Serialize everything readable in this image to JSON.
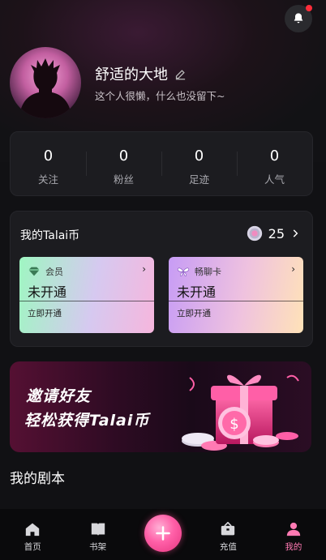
{
  "profile": {
    "name": "舒适的大地",
    "bio": "这个人很懒，什么也没留下~"
  },
  "stats": [
    {
      "value": "0",
      "label": "关注"
    },
    {
      "value": "0",
      "label": "粉丝"
    },
    {
      "value": "0",
      "label": "足迹"
    },
    {
      "value": "0",
      "label": "人气"
    }
  ],
  "coins": {
    "title": "我的Talai币",
    "count": "25"
  },
  "memberships": {
    "vip": {
      "name": "会员",
      "status": "未开通",
      "action": "立即开通"
    },
    "chat": {
      "name": "畅聊卡",
      "status": "未开通",
      "action": "立即开通"
    }
  },
  "banner": {
    "line1": "邀请好友",
    "line2": "轻松获得Talai币"
  },
  "section": {
    "scripts_title": "我的剧本"
  },
  "tabbar": {
    "home": "首页",
    "shelf": "书架",
    "recharge": "充值",
    "mine": "我的"
  },
  "colors": {
    "accent": "#ff7ab3",
    "notification_dot": "#ff2d3a",
    "background": "#111114",
    "card": "#1c1c20"
  },
  "icons": {
    "bell": "bell-icon",
    "edit": "edit-icon",
    "coin": "coin-icon",
    "home": "home-icon",
    "shelf": "book-icon",
    "plus": "plus-icon",
    "recharge": "wallet-icon",
    "mine": "user-icon"
  }
}
